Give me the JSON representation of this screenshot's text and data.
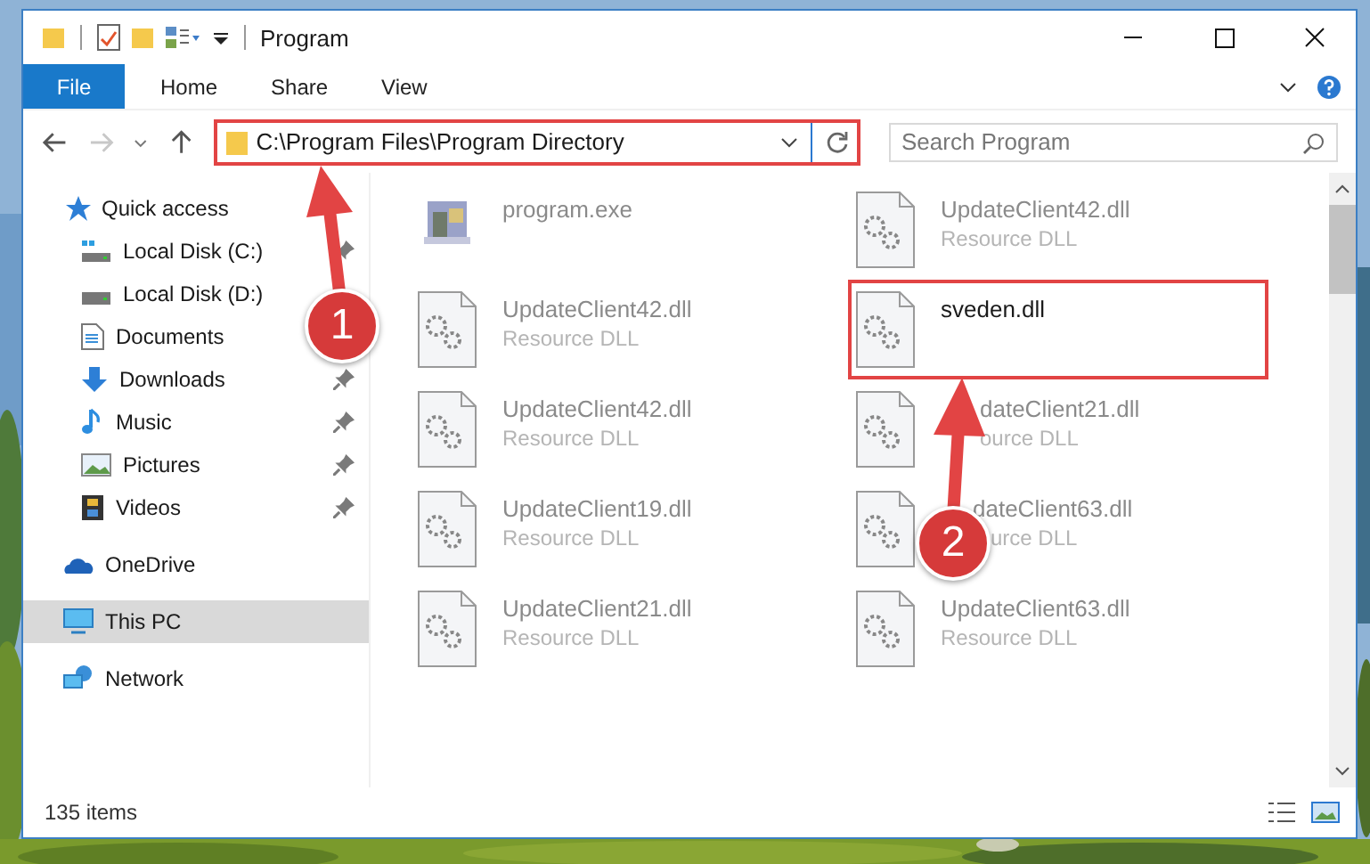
{
  "window": {
    "title": "Program"
  },
  "ribbon_tabs": [
    {
      "label": "File",
      "selected": true
    },
    {
      "label": "Home",
      "selected": false
    },
    {
      "label": "Share",
      "selected": false
    },
    {
      "label": "View",
      "selected": false
    }
  ],
  "address": {
    "path": "C:\\Program Files\\Program Directory",
    "highlighted": true
  },
  "search": {
    "placeholder": "Search Program"
  },
  "sidebar": {
    "items": [
      {
        "label": "Quick access",
        "kind": "star",
        "selected": false,
        "children": [
          {
            "label": "Local Disk (C:)",
            "kind": "drive-win",
            "pinned": true,
            "selected": false
          },
          {
            "label": "Local Disk (D:)",
            "kind": "drive",
            "pinned": false,
            "selected": false
          },
          {
            "label": "Documents",
            "kind": "documents",
            "pinned": false,
            "selected": false
          },
          {
            "label": "Downloads",
            "kind": "downloads",
            "pinned": true,
            "selected": false
          },
          {
            "label": "Music",
            "kind": "music",
            "pinned": true,
            "selected": false
          },
          {
            "label": "Pictures",
            "kind": "pictures",
            "pinned": true,
            "selected": false
          },
          {
            "label": "Videos",
            "kind": "videos",
            "pinned": true,
            "selected": false
          }
        ]
      },
      {
        "label": "OneDrive",
        "kind": "cloud",
        "selected": false
      },
      {
        "label": "This PC",
        "kind": "pc",
        "selected": true
      },
      {
        "label": "Network",
        "kind": "network",
        "selected": false
      }
    ]
  },
  "files": [
    {
      "name": "program.exe",
      "kind": "exe",
      "highlighted": false
    },
    {
      "name": "UpdateClient42.dll",
      "type": "Resource DLL",
      "kind": "dll",
      "highlighted": false
    },
    {
      "name": "UpdateClient42.dll",
      "type": "Resource DLL",
      "kind": "dll",
      "highlighted": false
    },
    {
      "name": "sveden.dll",
      "kind": "dll",
      "highlighted": true
    },
    {
      "name": "UpdateClient42.dll",
      "type": "Resource DLL",
      "kind": "dll",
      "highlighted": false
    },
    {
      "name": "dateClient21.dll",
      "type": "ource DLL",
      "kind": "dll",
      "highlighted": false
    },
    {
      "name": "UpdateClient19.dll",
      "type": "Resource DLL",
      "kind": "dll",
      "highlighted": false
    },
    {
      "name": "dateClient63.dll",
      "type": "urce DLL",
      "kind": "dll",
      "highlighted": false
    },
    {
      "name": "UpdateClient21.dll",
      "type": "Resource DLL",
      "kind": "dll",
      "highlighted": false
    },
    {
      "name": "UpdateClient63.dll",
      "type": "Resource DLL",
      "kind": "dll",
      "highlighted": false
    }
  ],
  "callouts": [
    {
      "label": "1"
    },
    {
      "label": "2"
    }
  ],
  "status_bar": {
    "item_count": "135 items"
  }
}
